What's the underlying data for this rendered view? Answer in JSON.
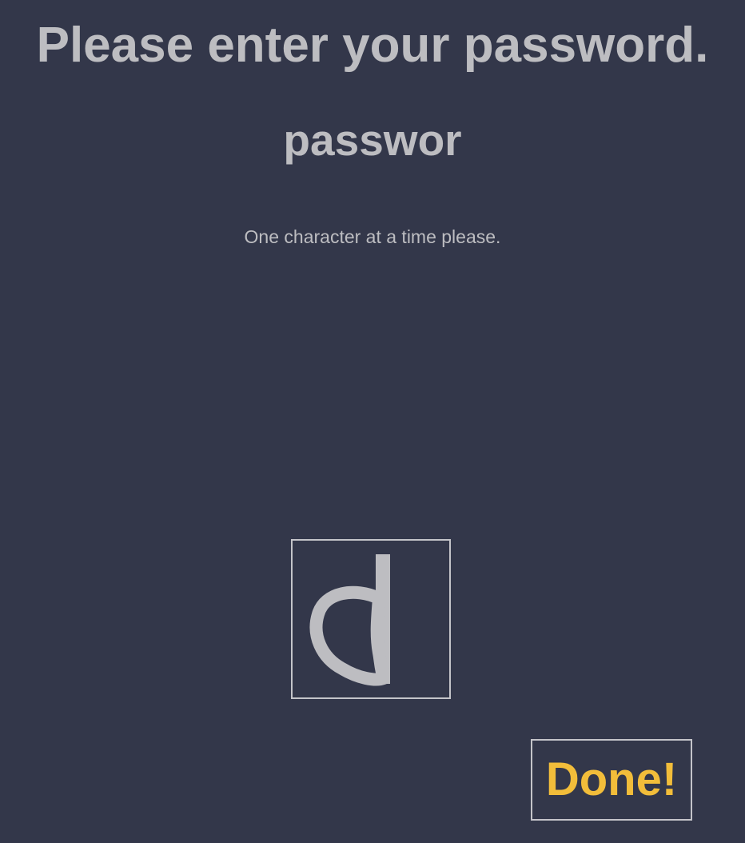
{
  "prompt": {
    "title": "Please enter your password.",
    "entered_text": "passwor",
    "hint": "One character at a time please."
  },
  "draw_pad": {
    "drawn_character": "d",
    "stroke_color": "#bdbdc1"
  },
  "actions": {
    "done_label": "Done!"
  },
  "colors": {
    "background": "#33374a",
    "text": "#bdbdc1",
    "accent": "#f2bd3a",
    "border": "#c4c4c9"
  }
}
